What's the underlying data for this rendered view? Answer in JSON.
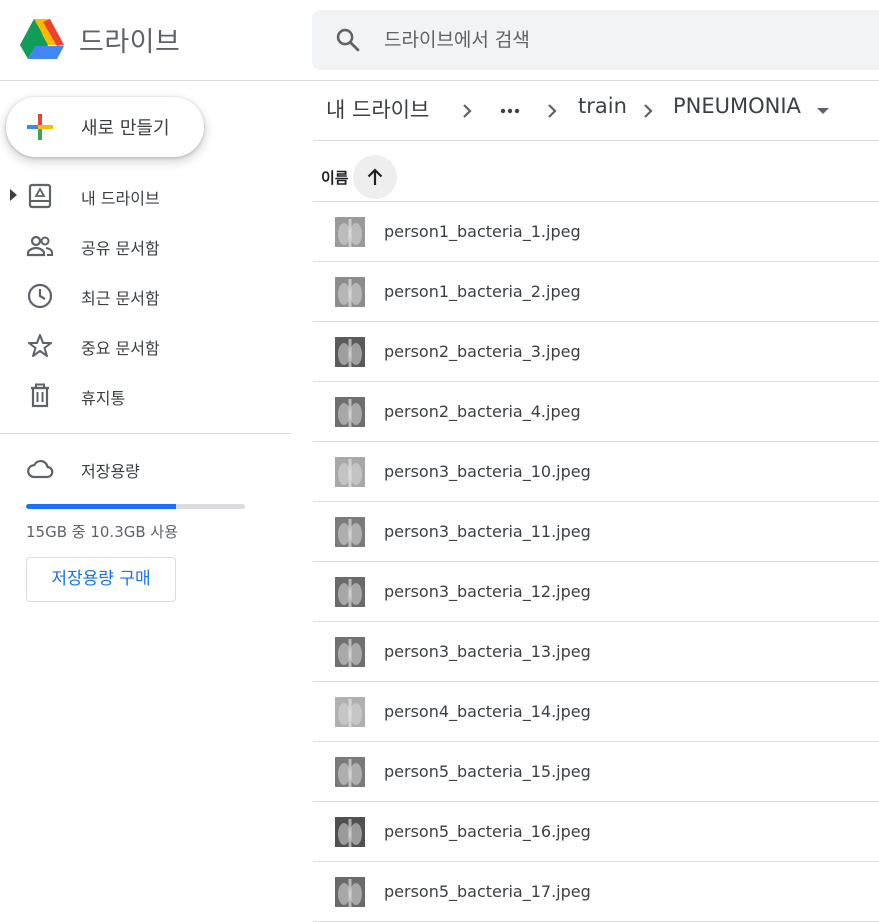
{
  "header": {
    "app_title": "드라이브",
    "logo_icon": "google-drive-logo",
    "search": {
      "placeholder": "드라이브에서 검색",
      "value": "",
      "icon": "search-icon"
    }
  },
  "sidebar": {
    "new_button": {
      "label": "새로 만들기",
      "icon": "plus-icon"
    },
    "items": [
      {
        "label": "내 드라이브",
        "icon": "drive-icon",
        "expandable": true
      },
      {
        "label": "공유 문서함",
        "icon": "people-icon"
      },
      {
        "label": "최근 문서함",
        "icon": "clock-icon"
      },
      {
        "label": "중요 문서함",
        "icon": "star-icon"
      },
      {
        "label": "휴지통",
        "icon": "trash-icon"
      }
    ],
    "storage": {
      "label": "저장용량",
      "icon": "cloud-icon",
      "usage_text": "15GB 중 10.3GB 사용",
      "used_fraction": 0.687,
      "buy_label": "저장용량 구매"
    }
  },
  "breadcrumb": {
    "root": "내 드라이브",
    "more": "more-horizontal-icon",
    "parent": "train",
    "current": "PNEUMONIA"
  },
  "list_header": {
    "sort_column": "이름",
    "sort_direction": "ascending",
    "sort_icon": "arrow-up-icon"
  },
  "files": [
    {
      "name": "person1_bacteria_1.jpeg"
    },
    {
      "name": "person1_bacteria_2.jpeg"
    },
    {
      "name": "person2_bacteria_3.jpeg"
    },
    {
      "name": "person2_bacteria_4.jpeg"
    },
    {
      "name": "person3_bacteria_10.jpeg"
    },
    {
      "name": "person3_bacteria_11.jpeg"
    },
    {
      "name": "person3_bacteria_12.jpeg"
    },
    {
      "name": "person3_bacteria_13.jpeg"
    },
    {
      "name": "person4_bacteria_14.jpeg"
    },
    {
      "name": "person5_bacteria_15.jpeg"
    },
    {
      "name": "person5_bacteria_16.jpeg"
    },
    {
      "name": "person5_bacteria_17.jpeg"
    }
  ],
  "colors": {
    "accent": "#1a73e8",
    "text_primary": "#202124",
    "text_secondary": "#5f6368",
    "divider": "#dadce0",
    "search_bg": "#f1f3f4"
  }
}
